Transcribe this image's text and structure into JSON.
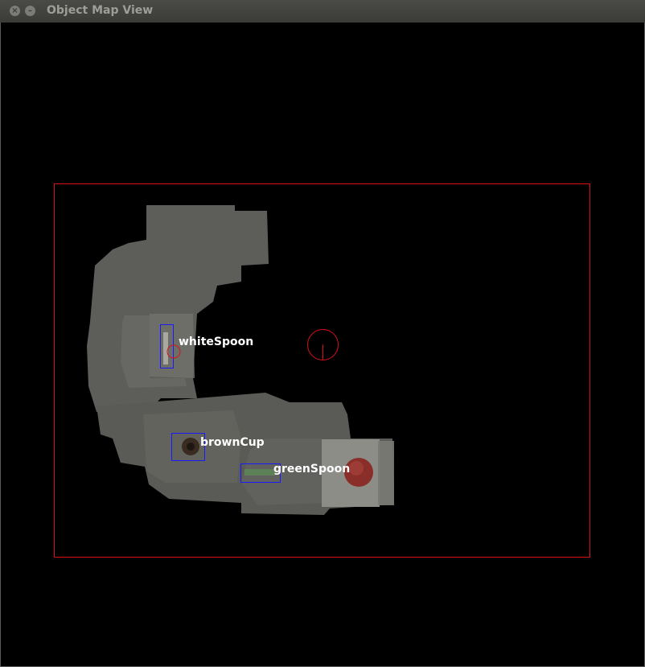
{
  "window": {
    "title": "Object Map View",
    "close_glyph": "×",
    "min_glyph": "–"
  },
  "map": {
    "objects": [
      {
        "label": "whiteSpoon"
      },
      {
        "label": "brownCup"
      },
      {
        "label": "greenSpoon"
      }
    ],
    "colors": {
      "bounds": "#d8111b",
      "bbox": "#1a1aff",
      "robot_marker": "#d8111b",
      "label": "#ffffff",
      "floor": "#5b5b57"
    }
  }
}
